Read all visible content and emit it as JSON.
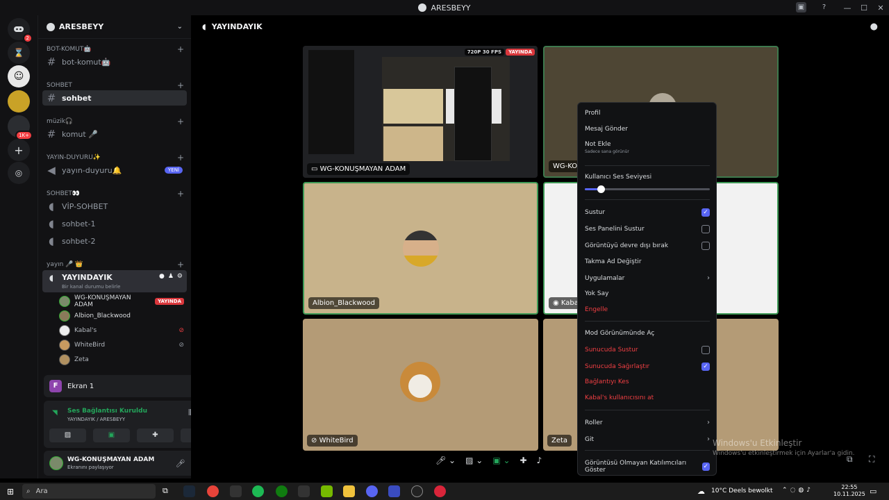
{
  "window": {
    "title": "ARESBEYY"
  },
  "servers": {
    "badges": [
      "2",
      "1K+"
    ]
  },
  "guild": {
    "name": "ARESBEYY"
  },
  "categories": {
    "bot": "BOT-KOMUT🤖",
    "sohbet": "SOHBET",
    "muzik": "müzik🎧",
    "yayin_duyuru": "YAYIN-DUYURU✨",
    "sohbet2": "SOHBET👀",
    "yayin": "yayın 🎤 👑"
  },
  "channels": {
    "bot_komut": "bot-komut🤖",
    "sohbet": "sohbet",
    "komut": "komut 🎤",
    "yayin_duyuru": "yayın-duyuru🔔",
    "yeni": "YENİ",
    "vip": "VİP-SOHBET",
    "sohbet1": "sohbet-1",
    "sohbet2": "sohbet-2",
    "yayindayik": "YAYINDAYIK",
    "status_hint": "Bir kanal durumu belirle"
  },
  "voice_users": [
    {
      "name": "WG-KONUŞMAYAN ADAM",
      "badge": "YAYINDA"
    },
    {
      "name": "Albion_Blackwood"
    },
    {
      "name": "Kabal's"
    },
    {
      "name": "WhiteBird"
    },
    {
      "name": "Zeta"
    }
  ],
  "stream_panel": {
    "title": "Ekran 1"
  },
  "voice_panel": {
    "status": "Ses Bağlantısı Kuruldu",
    "location": "YAYINDAYIK / ARESBEYY"
  },
  "user_panel": {
    "name": "WG-KONUŞMAYAN ADAM",
    "status": "Ekranını paylaşıyor"
  },
  "main": {
    "header": "YAYINDAYIK"
  },
  "tiles": {
    "stream": {
      "name": "WG-KONUŞMAYAN ADAM",
      "quality": "720P 30 FPS",
      "live": "YAYINDA"
    },
    "kabal_top": {
      "name": "WG-KON"
    },
    "albion": {
      "name": "Albion_Blackwood"
    },
    "kabal": {
      "name": "Kabal"
    },
    "whitebird": {
      "name": "WhiteBird"
    },
    "zeta": {
      "name": "Zeta"
    }
  },
  "context_menu": {
    "profil": "Profil",
    "mesaj": "Mesaj Gönder",
    "not": "Not Ekle",
    "not_sub": "Sadece sana görünür",
    "volume_label": "Kullanıcı Ses Seviyesi",
    "volume": 0.13,
    "sustur": "Sustur",
    "ses_paneli": "Ses Panelini Sustur",
    "goruntu": "Görüntüyü devre dışı bırak",
    "takma_ad": "Takma Ad Değiştir",
    "uygulamalar": "Uygulamalar",
    "yok_say": "Yok Say",
    "engelle": "Engelle",
    "mod": "Mod Görünümünde Aç",
    "sunucuda_sustur": "Sunucuda Sustur",
    "sunucuda_sagir": "Sunucuda Sağırlaştır",
    "baglanti": "Bağlantıyı Kes",
    "kullanici_at": "Kabal's kullanıcısını at",
    "roller": "Roller",
    "git": "Git",
    "goster": "Görüntüsü Olmayan Katılımcıları Göster"
  },
  "watermark": {
    "title": "Windows'u Etkinleştir",
    "subtitle": "Windows'u etkinleştirmek için Ayarlar'a gidin."
  },
  "taskbar": {
    "search": "Ara",
    "weather": "10°C  Deels bewolkt",
    "time": "22:55",
    "date": "10.11.2025"
  }
}
